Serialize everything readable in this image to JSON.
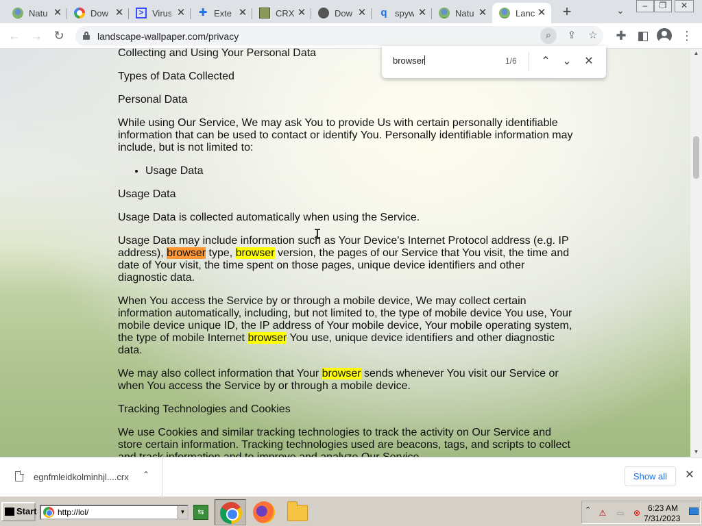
{
  "browser": {
    "tabs": [
      {
        "title": "Natu",
        "icon": "landscape-favicon",
        "active": false
      },
      {
        "title": "Dow",
        "icon": "google-favicon",
        "active": false
      },
      {
        "title": "Virus",
        "icon": "virustotal-favicon",
        "active": false
      },
      {
        "title": "Exte",
        "icon": "extensions-favicon",
        "active": false
      },
      {
        "title": "CRX",
        "icon": "crx-favicon",
        "active": false
      },
      {
        "title": "Dow",
        "icon": "download-favicon",
        "active": false
      },
      {
        "title": "spyw",
        "icon": "search-favicon",
        "active": false
      },
      {
        "title": "Natu",
        "icon": "landscape-favicon",
        "active": false
      },
      {
        "title": "Lanc",
        "icon": "landscape-favicon",
        "active": true
      }
    ],
    "url": "landscape-wallpaper.com/privacy"
  },
  "find_bar": {
    "query": "browser",
    "count": "1/6"
  },
  "article": {
    "h_collecting": "Collecting and Using Your Personal Data",
    "h_types": "Types of Data Collected",
    "h_personal": "Personal Data",
    "p_personal": "While using Our Service, We may ask You to provide Us with certain personally identifiable information that can be used to contact or identify You. Personally identifiable information may include, but is not limited to:",
    "list_items": [
      "Usage Data"
    ],
    "h_usage": "Usage Data",
    "p_usage_auto": "Usage Data is collected automatically when using the Service.",
    "p_usage_1a": "Usage Data may include information such as Your Device's Internet Protocol address (e.g. IP address), ",
    "hl_1": "browser",
    "p_usage_1b": " type, ",
    "hl_2": "browser",
    "p_usage_1c": " version, the pages of our Service that You visit, the time and date of Your visit, the time spent on those pages, unique device identifiers and other diagnostic data.",
    "p_mobile_a": "When You access the Service by or through a mobile device, We may collect certain information automatically, including, but not limited to, the type of mobile device You use, Your mobile device unique ID, the IP address of Your mobile device, Your mobile operating system, the type of mobile Internet ",
    "hl_3": "browser",
    "p_mobile_b": " You use, unique device identifiers and other diagnostic data.",
    "p_collect_a": "We may also collect information that Your ",
    "hl_4": "browser",
    "p_collect_b": " sends whenever You visit our Service or when You access the Service by or through a mobile device.",
    "h_tracking": "Tracking Technologies and Cookies",
    "p_cookies": "We use Cookies and similar tracking technologies to track the activity on Our Service and store certain information. Tracking technologies used are beacons, tags, and scripts to collect and track information and to improve and analyze Our Service."
  },
  "download_shelf": {
    "file_name": "egnfmleidkolminhjl....crx",
    "show_all_label": "Show all"
  },
  "taskbar": {
    "start_label": "Start",
    "address_value": "http://lol/",
    "clock_time": "6:23 AM",
    "clock_date": "7/31/2023"
  },
  "colors": {
    "find_highlight": "#ffff00",
    "find_current": "#ff9632",
    "link_blue": "#1a73e8"
  }
}
